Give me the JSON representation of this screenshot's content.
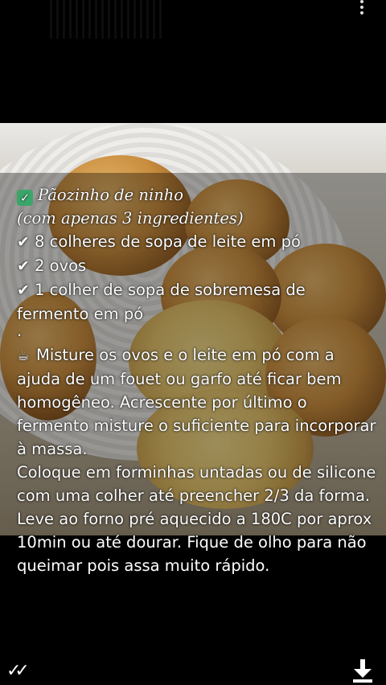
{
  "caption": {
    "title": "Pãozinho de ninho",
    "subtitle": "(com apenas 3 ingredientes)",
    "ingredients": [
      "8 colheres de sopa de leite em pó",
      "2 ovos",
      "1 colher de sopa de sobremesa de"
    ],
    "ingredient_continued": "fermento em pó",
    "separator": ".",
    "instructions": [
      "Misture os ovos e o leite em pó com a",
      "ajuda de um fouet ou garfo até ficar bem",
      "homogêneo. Acrescente por último o",
      "fermento misture o suficiente para incorporar",
      "à massa.",
      "Coloque em forminhas untadas ou de silicone",
      "com uma colher até preencher 2/3 da forma.",
      "Leve ao forno pré aquecido a 180C por aprox",
      "10min ou até dourar. Fique de olho para não",
      "queimar pois assa muito rápido."
    ]
  },
  "icons": {
    "title_check": "check-box-icon",
    "ingredient_tick": "check-mark-icon",
    "instruction_chef": "chef-icon",
    "menu": "more-vert-icon",
    "read_status": "double-check-icon",
    "download": "download-icon"
  },
  "colors": {
    "background": "#000000",
    "text": "#ffffff",
    "check_box": "#3aa66a"
  }
}
